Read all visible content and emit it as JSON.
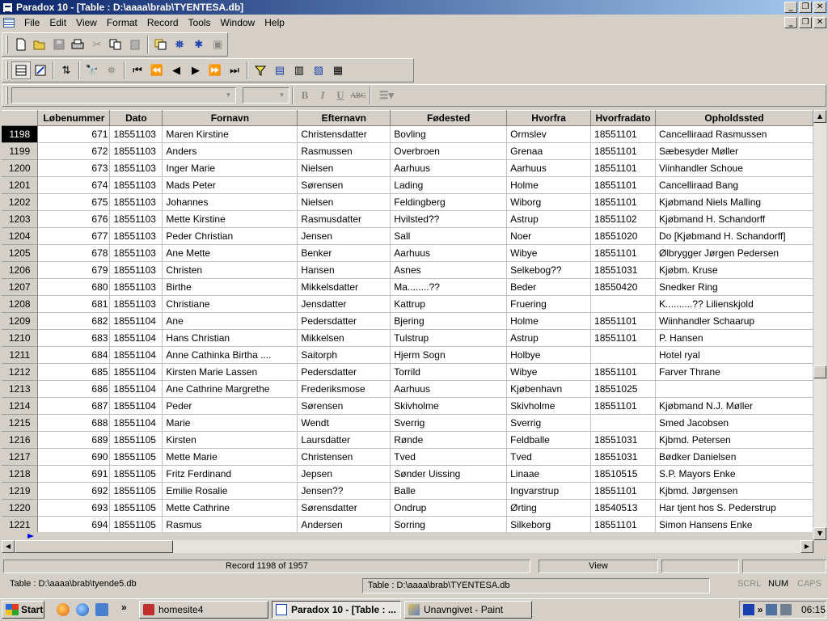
{
  "window": {
    "title": "Paradox 10 - [Table : D:\\aaaa\\brab\\TYENTESA.db]"
  },
  "menu": [
    "File",
    "Edit",
    "View",
    "Format",
    "Record",
    "Tools",
    "Window",
    "Help"
  ],
  "table": {
    "columns": [
      "",
      "Løbenummer",
      "Dato",
      "Fornavn",
      "Efternavn",
      "Fødested",
      "Hvorfra",
      "Hvorfradato",
      "Opholdssted"
    ],
    "current_row": "1198",
    "rows": [
      [
        "1198",
        "671",
        "18551103",
        "Maren Kirstine",
        "Christensdatter",
        "Bovling",
        "Ormslev",
        "18551101",
        "Cancelliraad Rasmussen"
      ],
      [
        "1199",
        "672",
        "18551103",
        "Anders",
        "Rasmussen",
        "Overbroen",
        "Grenaa",
        "18551101",
        "Sæbesyder Møller"
      ],
      [
        "1200",
        "673",
        "18551103",
        "Inger Marie",
        "Nielsen",
        "Aarhuus",
        "Aarhuus",
        "18551101",
        "Viinhandler Schoue"
      ],
      [
        "1201",
        "674",
        "18551103",
        "Mads Peter",
        "Sørensen",
        "Lading",
        "Holme",
        "18551101",
        "Cancelliraad Bang"
      ],
      [
        "1202",
        "675",
        "18551103",
        "Johannes",
        "Nielsen",
        "Feldingberg",
        "Wiborg",
        "18551101",
        "Kjøbmand Niels Malling"
      ],
      [
        "1203",
        "676",
        "18551103",
        "Mette Kirstine",
        "Rasmusdatter",
        "Hvilsted??",
        "Astrup",
        "18551102",
        "Kjøbmand H. Schandorff"
      ],
      [
        "1204",
        "677",
        "18551103",
        "Peder Christian",
        "Jensen",
        "Sall",
        "Noer",
        "18551020",
        "Do [Kjøbmand H. Schandorff]"
      ],
      [
        "1205",
        "678",
        "18551103",
        "Ane Mette",
        "Benker",
        "Aarhuus",
        "Wibye",
        "18551101",
        "Ølbrygger Jørgen Pedersen"
      ],
      [
        "1206",
        "679",
        "18551103",
        "Christen",
        "Hansen",
        "Asnes",
        "Selkebog??",
        "18551031",
        "Kjøbm. Kruse"
      ],
      [
        "1207",
        "680",
        "18551103",
        "Birthe",
        "Mikkelsdatter",
        "Ma........??",
        "Beder",
        "18550420",
        "Snedker Ring"
      ],
      [
        "1208",
        "681",
        "18551103",
        "Christiane",
        "Jensdatter",
        "Kattrup",
        "Fruering",
        "",
        "K..........?? Lilienskjold"
      ],
      [
        "1209",
        "682",
        "18551104",
        "Ane",
        "Pedersdatter",
        "Bjering",
        "Holme",
        "18551101",
        "Wiinhandler Schaarup"
      ],
      [
        "1210",
        "683",
        "18551104",
        "Hans Christian",
        "Mikkelsen",
        "Tulstrup",
        "Astrup",
        "18551101",
        "P. Hansen"
      ],
      [
        "1211",
        "684",
        "18551104",
        "Anne Cathinka Birtha ....",
        "Saitorph",
        "Hjerm Sogn",
        "Holbye",
        "",
        "Hotel ryal"
      ],
      [
        "1212",
        "685",
        "18551104",
        "Kirsten Marie Lassen",
        "Pedersdatter",
        "Torrild",
        "Wibye",
        "18551101",
        "Farver Thrane"
      ],
      [
        "1213",
        "686",
        "18551104",
        "Ane Cathrine Margrethe",
        "Frederiksmose",
        "Aarhuus",
        "Kjøbenhavn",
        "18551025",
        ""
      ],
      [
        "1214",
        "687",
        "18551104",
        "Peder",
        "Sørensen",
        "Skivholme",
        "Skivholme",
        "18551101",
        "Kjøbmand N.J. Møller"
      ],
      [
        "1215",
        "688",
        "18551104",
        "Marie",
        "Wendt",
        "Sverrig",
        "Sverrig",
        "",
        "Smed Jacobsen"
      ],
      [
        "1216",
        "689",
        "18551105",
        "Kirsten",
        "Laursdatter",
        "Rønde",
        "Feldballe",
        "18551031",
        "Kjbmd. Petersen"
      ],
      [
        "1217",
        "690",
        "18551105",
        "Mette Marie",
        "Christensen",
        "Tved",
        "Tved",
        "18551031",
        "Bødker Danielsen"
      ],
      [
        "1218",
        "691",
        "18551105",
        "Fritz Ferdinand",
        "Jepsen",
        "Sønder Uissing",
        "Linaae",
        "18510515",
        "S.P. Mayors Enke"
      ],
      [
        "1219",
        "692",
        "18551105",
        "Emilie Rosalie",
        "Jensen??",
        "Balle",
        "Ingvarstrup",
        "18551101",
        "Kjbmd. Jørgensen"
      ],
      [
        "1220",
        "693",
        "18551105",
        "Mette Cathrine",
        "Sørensdatter",
        "Ondrup",
        "Ørting",
        "18540513",
        "Har tjent hos S. Pederstrup"
      ],
      [
        "1221",
        "694",
        "18551105",
        "Rasmus",
        "Andersen",
        "Sorring",
        "Silkeborg",
        "18551101",
        "Simon Hansens Enke"
      ]
    ]
  },
  "status": {
    "record": "Record 1198 of 1957",
    "mode": "View",
    "table_left": "Table : D:\\aaaa\\brab\\tyende5.db",
    "table_right": "Table : D:\\aaaa\\brab\\TYENTESA.db",
    "scrl": "SCRL",
    "num": "NUM",
    "caps": "CAPS"
  },
  "taskbar": {
    "start": "Start",
    "tasks": [
      "homesite4",
      "Paradox 10 - [Table : ...",
      "Unavngivet - Paint"
    ],
    "clock": "06:15",
    "chevron": "»"
  },
  "glyphs": {
    "minimize": "_",
    "restore": "❐",
    "close": "✕",
    "up": "▲",
    "down": "▼",
    "left": "◀",
    "right": "▶",
    "bold": "B",
    "italic": "I",
    "underline": "U",
    "strike": "ABC"
  }
}
